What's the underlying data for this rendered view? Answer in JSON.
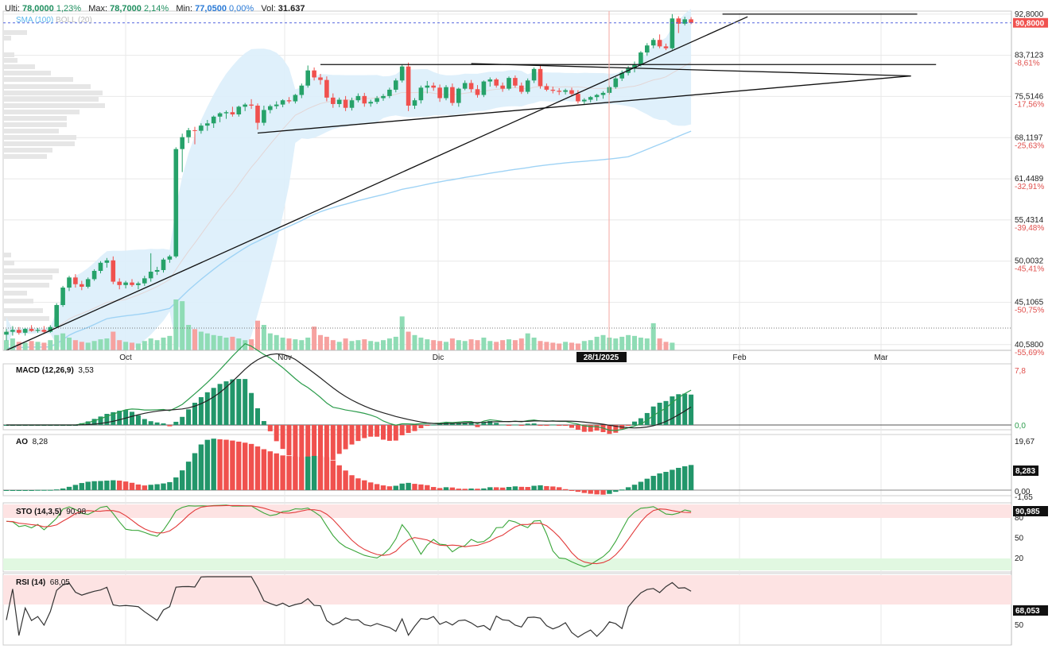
{
  "header": {
    "last_label": "Ulti:",
    "last_value": "78,0000",
    "last_change": "1,23%",
    "max_label": "Max:",
    "max_value": "78,7000",
    "max_change": "2,14%",
    "min_label": "Min:",
    "min_value": "77,0500",
    "min_change": "0,00%",
    "vol_label": "Vol:",
    "vol_value": "31.637",
    "overlay_sma": "SMA (100)",
    "overlay_boll": "BOLL (20)"
  },
  "colors": {
    "up": "#26a269",
    "down": "#f0514e",
    "band": "#dbeefb",
    "sma": "#9fd3f5",
    "grid": "#e8e8e8",
    "pricebox": "#f0514e",
    "hist_up": "#22966a",
    "hist_down": "#f0514e"
  },
  "price_axis": {
    "current_price_box": "90,8000",
    "ticks": [
      {
        "price": "92,8000",
        "pct": "1,10%",
        "v": 92.8
      },
      {
        "price": "83,7123",
        "pct": "-8,61%",
        "v": 83.7123
      },
      {
        "price": "75,5146",
        "pct": "-17,56%",
        "v": 75.5146
      },
      {
        "price": "68,1197",
        "pct": "-25,63%",
        "v": 68.1197
      },
      {
        "price": "61,4489",
        "pct": "-32,91%",
        "v": 61.4489
      },
      {
        "price": "55,4314",
        "pct": "-39,48%",
        "v": 55.4314
      },
      {
        "price": "50,0032",
        "pct": "-45,41%",
        "v": 50.0032
      },
      {
        "price": "45,1065",
        "pct": "-50,75%",
        "v": 45.1065
      },
      {
        "price": "40,5800",
        "pct": "-55,69%",
        "v": 40.58
      }
    ]
  },
  "time_axis": {
    "labels": [
      "Oct",
      "Nov",
      "Dic",
      "Feb",
      "Mar"
    ],
    "cursor_label": "28/1/2025"
  },
  "panes": {
    "macd": {
      "label": "MACD (12,26,9)",
      "value": "3,53",
      "axis": [
        "7,8",
        "0,0"
      ]
    },
    "ao": {
      "label": "AO",
      "value": "8,28",
      "axis": [
        "19,67",
        "8,283",
        "0,00",
        "-1,65"
      ]
    },
    "sto": {
      "label": "STO (14,3,5)",
      "value": "90,98",
      "axis": [
        "90,985",
        "80",
        "50",
        "20"
      ]
    },
    "rsi": {
      "label": "RSI (14)",
      "value": "68,05",
      "axis": [
        "68,053",
        "50"
      ]
    }
  },
  "chart_data": {
    "type": "candlestick",
    "scale": "log",
    "ylim": [
      40.0,
      93.5
    ],
    "x_labels": [
      "Oct",
      "Nov",
      "Dic",
      "Feb",
      "Mar"
    ],
    "candles": [
      {
        "o": 41.6,
        "h": 42.2,
        "l": 41.0,
        "c": 41.9
      },
      {
        "o": 41.9,
        "h": 42.5,
        "l": 41.5,
        "c": 42.1
      },
      {
        "o": 42.1,
        "h": 42.4,
        "l": 41.6,
        "c": 41.8
      },
      {
        "o": 41.8,
        "h": 42.3,
        "l": 41.5,
        "c": 42.2
      },
      {
        "o": 42.2,
        "h": 42.6,
        "l": 41.9,
        "c": 42.0
      },
      {
        "o": 42.0,
        "h": 42.3,
        "l": 41.8,
        "c": 42.1
      },
      {
        "o": 42.1,
        "h": 42.5,
        "l": 41.7,
        "c": 41.9
      },
      {
        "o": 41.9,
        "h": 42.6,
        "l": 41.8,
        "c": 42.4
      },
      {
        "o": 42.4,
        "h": 45.0,
        "l": 42.3,
        "c": 44.8
      },
      {
        "o": 44.8,
        "h": 47.0,
        "l": 44.6,
        "c": 46.8
      },
      {
        "o": 46.8,
        "h": 48.2,
        "l": 46.4,
        "c": 48.0
      },
      {
        "o": 48.0,
        "h": 48.4,
        "l": 46.8,
        "c": 47.2
      },
      {
        "o": 47.2,
        "h": 47.6,
        "l": 46.5,
        "c": 46.9
      },
      {
        "o": 46.9,
        "h": 48.0,
        "l": 46.7,
        "c": 47.8
      },
      {
        "o": 47.8,
        "h": 49.0,
        "l": 47.6,
        "c": 48.8
      },
      {
        "o": 48.8,
        "h": 50.0,
        "l": 48.5,
        "c": 49.8
      },
      {
        "o": 49.8,
        "h": 50.4,
        "l": 49.2,
        "c": 50.1
      },
      {
        "o": 50.1,
        "h": 50.6,
        "l": 47.2,
        "c": 47.5
      },
      {
        "o": 47.5,
        "h": 47.9,
        "l": 46.6,
        "c": 47.1
      },
      {
        "o": 47.1,
        "h": 47.6,
        "l": 46.7,
        "c": 47.4
      },
      {
        "o": 47.4,
        "h": 47.8,
        "l": 46.9,
        "c": 47.1
      },
      {
        "o": 47.1,
        "h": 47.5,
        "l": 46.6,
        "c": 47.3
      },
      {
        "o": 47.3,
        "h": 48.2,
        "l": 47.0,
        "c": 47.9
      },
      {
        "o": 47.9,
        "h": 51.0,
        "l": 47.5,
        "c": 48.7
      },
      {
        "o": 48.7,
        "h": 49.3,
        "l": 48.3,
        "c": 48.9
      },
      {
        "o": 48.9,
        "h": 50.4,
        "l": 48.6,
        "c": 50.2
      },
      {
        "o": 50.2,
        "h": 50.8,
        "l": 49.8,
        "c": 50.6
      },
      {
        "o": 50.6,
        "h": 66.5,
        "l": 50.4,
        "c": 66.2
      },
      {
        "o": 66.2,
        "h": 68.8,
        "l": 62.5,
        "c": 68.2
      },
      {
        "o": 68.2,
        "h": 69.8,
        "l": 67.2,
        "c": 69.4
      },
      {
        "o": 69.4,
        "h": 70.0,
        "l": 67.0,
        "c": 69.3
      },
      {
        "o": 69.3,
        "h": 70.6,
        "l": 68.8,
        "c": 70.2
      },
      {
        "o": 70.2,
        "h": 71.2,
        "l": 69.3,
        "c": 70.6
      },
      {
        "o": 70.6,
        "h": 72.0,
        "l": 69.8,
        "c": 71.8
      },
      {
        "o": 71.8,
        "h": 72.6,
        "l": 70.8,
        "c": 72.4
      },
      {
        "o": 72.4,
        "h": 72.9,
        "l": 71.4,
        "c": 72.6
      },
      {
        "o": 72.6,
        "h": 73.6,
        "l": 71.8,
        "c": 72.2
      },
      {
        "o": 72.2,
        "h": 73.8,
        "l": 71.8,
        "c": 73.6
      },
      {
        "o": 73.6,
        "h": 74.3,
        "l": 72.8,
        "c": 74.0
      },
      {
        "o": 74.0,
        "h": 75.0,
        "l": 73.2,
        "c": 73.8
      },
      {
        "o": 73.8,
        "h": 74.2,
        "l": 69.5,
        "c": 70.7
      },
      {
        "o": 70.7,
        "h": 73.8,
        "l": 70.2,
        "c": 73.0
      },
      {
        "o": 73.0,
        "h": 74.0,
        "l": 72.4,
        "c": 73.7
      },
      {
        "o": 73.7,
        "h": 74.6,
        "l": 73.2,
        "c": 74.0
      },
      {
        "o": 74.0,
        "h": 75.0,
        "l": 73.5,
        "c": 74.8
      },
      {
        "o": 74.8,
        "h": 75.4,
        "l": 74.2,
        "c": 74.6
      },
      {
        "o": 74.6,
        "h": 76.0,
        "l": 74.2,
        "c": 75.8
      },
      {
        "o": 75.8,
        "h": 78.0,
        "l": 75.2,
        "c": 77.6
      },
      {
        "o": 77.6,
        "h": 81.6,
        "l": 77.2,
        "c": 80.6
      },
      {
        "o": 80.6,
        "h": 81.2,
        "l": 78.6,
        "c": 79.2
      },
      {
        "o": 79.2,
        "h": 79.9,
        "l": 77.8,
        "c": 78.7
      },
      {
        "o": 78.7,
        "h": 79.4,
        "l": 74.6,
        "c": 75.3
      },
      {
        "o": 75.3,
        "h": 76.1,
        "l": 73.4,
        "c": 74.1
      },
      {
        "o": 74.1,
        "h": 75.3,
        "l": 73.5,
        "c": 74.9
      },
      {
        "o": 74.9,
        "h": 75.6,
        "l": 72.8,
        "c": 73.4
      },
      {
        "o": 73.4,
        "h": 75.3,
        "l": 72.9,
        "c": 74.8
      },
      {
        "o": 74.8,
        "h": 76.1,
        "l": 74.4,
        "c": 75.6
      },
      {
        "o": 75.6,
        "h": 76.2,
        "l": 73.6,
        "c": 74.2
      },
      {
        "o": 74.2,
        "h": 74.9,
        "l": 73.6,
        "c": 74.5
      },
      {
        "o": 74.5,
        "h": 75.6,
        "l": 74.1,
        "c": 75.2
      },
      {
        "o": 75.2,
        "h": 76.0,
        "l": 74.7,
        "c": 75.6
      },
      {
        "o": 75.6,
        "h": 77.2,
        "l": 75.2,
        "c": 76.8
      },
      {
        "o": 76.8,
        "h": 79.0,
        "l": 76.3,
        "c": 78.6
      },
      {
        "o": 78.6,
        "h": 81.8,
        "l": 78.2,
        "c": 81.4
      },
      {
        "o": 81.4,
        "h": 82.2,
        "l": 72.8,
        "c": 73.8
      },
      {
        "o": 73.8,
        "h": 75.2,
        "l": 73.2,
        "c": 74.8
      },
      {
        "o": 74.8,
        "h": 77.6,
        "l": 74.2,
        "c": 77.2
      },
      {
        "o": 77.2,
        "h": 78.5,
        "l": 76.1,
        "c": 77.6
      },
      {
        "o": 77.6,
        "h": 78.2,
        "l": 76.6,
        "c": 77.2
      },
      {
        "o": 77.2,
        "h": 77.8,
        "l": 74.5,
        "c": 75.2
      },
      {
        "o": 75.2,
        "h": 77.7,
        "l": 74.8,
        "c": 77.3
      },
      {
        "o": 77.3,
        "h": 78.0,
        "l": 73.8,
        "c": 74.3
      },
      {
        "o": 74.3,
        "h": 77.2,
        "l": 73.6,
        "c": 77.0
      },
      {
        "o": 77.0,
        "h": 78.6,
        "l": 76.7,
        "c": 78.1
      },
      {
        "o": 78.1,
        "h": 78.7,
        "l": 76.3,
        "c": 76.9
      },
      {
        "o": 76.9,
        "h": 77.7,
        "l": 75.3,
        "c": 75.8
      },
      {
        "o": 75.8,
        "h": 78.6,
        "l": 75.4,
        "c": 78.4
      },
      {
        "o": 78.4,
        "h": 79.2,
        "l": 77.4,
        "c": 78.8
      },
      {
        "o": 78.8,
        "h": 79.1,
        "l": 77.2,
        "c": 77.6
      },
      {
        "o": 77.6,
        "h": 78.2,
        "l": 76.4,
        "c": 77.0
      },
      {
        "o": 77.0,
        "h": 79.4,
        "l": 76.7,
        "c": 79.1
      },
      {
        "o": 79.1,
        "h": 79.6,
        "l": 77.2,
        "c": 77.6
      },
      {
        "o": 77.6,
        "h": 78.2,
        "l": 76.0,
        "c": 76.4
      },
      {
        "o": 76.4,
        "h": 79.0,
        "l": 76.0,
        "c": 78.6
      },
      {
        "o": 78.6,
        "h": 81.2,
        "l": 78.1,
        "c": 80.9
      },
      {
        "o": 80.9,
        "h": 81.6,
        "l": 77.0,
        "c": 77.5
      },
      {
        "o": 77.5,
        "h": 78.0,
        "l": 76.5,
        "c": 76.8
      },
      {
        "o": 76.8,
        "h": 77.4,
        "l": 76.1,
        "c": 76.6
      },
      {
        "o": 76.6,
        "h": 77.1,
        "l": 75.8,
        "c": 76.4
      },
      {
        "o": 76.4,
        "h": 77.0,
        "l": 75.9,
        "c": 76.7
      },
      {
        "o": 76.7,
        "h": 77.2,
        "l": 75.6,
        "c": 76.0
      },
      {
        "o": 76.0,
        "h": 76.7,
        "l": 74.2,
        "c": 74.6
      },
      {
        "o": 74.6,
        "h": 75.2,
        "l": 74.1,
        "c": 74.9
      },
      {
        "o": 74.9,
        "h": 75.6,
        "l": 74.4,
        "c": 75.4
      },
      {
        "o": 75.4,
        "h": 76.0,
        "l": 74.7,
        "c": 75.8
      },
      {
        "o": 75.8,
        "h": 76.5,
        "l": 75.1,
        "c": 76.2
      },
      {
        "o": 76.2,
        "h": 77.6,
        "l": 75.9,
        "c": 77.3
      },
      {
        "o": 77.3,
        "h": 79.3,
        "l": 77.0,
        "c": 79.0
      },
      {
        "o": 79.0,
        "h": 80.6,
        "l": 78.5,
        "c": 80.1
      },
      {
        "o": 80.1,
        "h": 81.5,
        "l": 79.6,
        "c": 81.0
      },
      {
        "o": 81.0,
        "h": 82.4,
        "l": 80.2,
        "c": 81.8
      },
      {
        "o": 81.8,
        "h": 84.6,
        "l": 81.4,
        "c": 84.3
      },
      {
        "o": 84.3,
        "h": 86.3,
        "l": 83.6,
        "c": 85.8
      },
      {
        "o": 85.8,
        "h": 87.4,
        "l": 85.2,
        "c": 87.0
      },
      {
        "o": 87.0,
        "h": 88.2,
        "l": 85.2,
        "c": 85.6
      },
      {
        "o": 85.6,
        "h": 86.2,
        "l": 84.8,
        "c": 85.2
      },
      {
        "o": 85.2,
        "h": 92.8,
        "l": 84.9,
        "c": 91.8
      },
      {
        "o": 91.8,
        "h": 92.3,
        "l": 88.5,
        "c": 90.6
      },
      {
        "o": 90.6,
        "h": 92.2,
        "l": 90.2,
        "c": 91.6
      },
      {
        "o": 91.6,
        "h": 92.1,
        "l": 90.5,
        "c": 90.8
      }
    ],
    "volume": [
      12,
      14,
      10,
      9,
      11,
      10,
      9,
      12,
      18,
      20,
      15,
      12,
      10,
      9,
      11,
      13,
      14,
      22,
      12,
      10,
      9,
      8,
      11,
      14,
      12,
      15,
      17,
      60,
      58,
      30,
      25,
      22,
      20,
      18,
      17,
      15,
      16,
      14,
      12,
      13,
      35,
      30,
      20,
      18,
      15,
      14,
      13,
      12,
      15,
      28,
      18,
      16,
      12,
      10,
      14,
      11,
      12,
      13,
      11,
      10,
      12,
      14,
      16,
      40,
      22,
      18,
      15,
      13,
      12,
      11,
      10,
      14,
      12,
      11,
      13,
      12,
      15,
      11,
      10,
      12,
      13,
      12,
      14,
      20,
      15,
      11,
      10,
      9,
      8,
      10,
      9,
      8,
      11,
      12,
      16,
      18,
      15,
      14,
      16,
      18,
      17,
      15,
      14,
      32,
      14,
      10,
      9
    ],
    "bollinger": {
      "upper_by_index": "computed",
      "period": 20
    },
    "sma_100": "computed",
    "trendlines": [
      {
        "name": "long-uptrend",
        "x1_index": 0,
        "y1": 40.0,
        "x2_index": 118,
        "y2": 92.2
      },
      {
        "name": "triangle-upper",
        "x1_index": 74,
        "y1": 82.0,
        "x2_index": 144,
        "y2": 79.5
      },
      {
        "name": "triangle-lower",
        "x1_index": 40,
        "y1": 68.9,
        "x2_index": 144,
        "y2": 79.5
      },
      {
        "name": "horizontal-resistance",
        "x1_index": 50,
        "y1": 81.8,
        "x2_index": 148,
        "y2": 81.8
      },
      {
        "name": "top-line",
        "x1_index": 114,
        "y1": 92.8,
        "x2_index": 145,
        "y2": 92.8
      }
    ]
  }
}
